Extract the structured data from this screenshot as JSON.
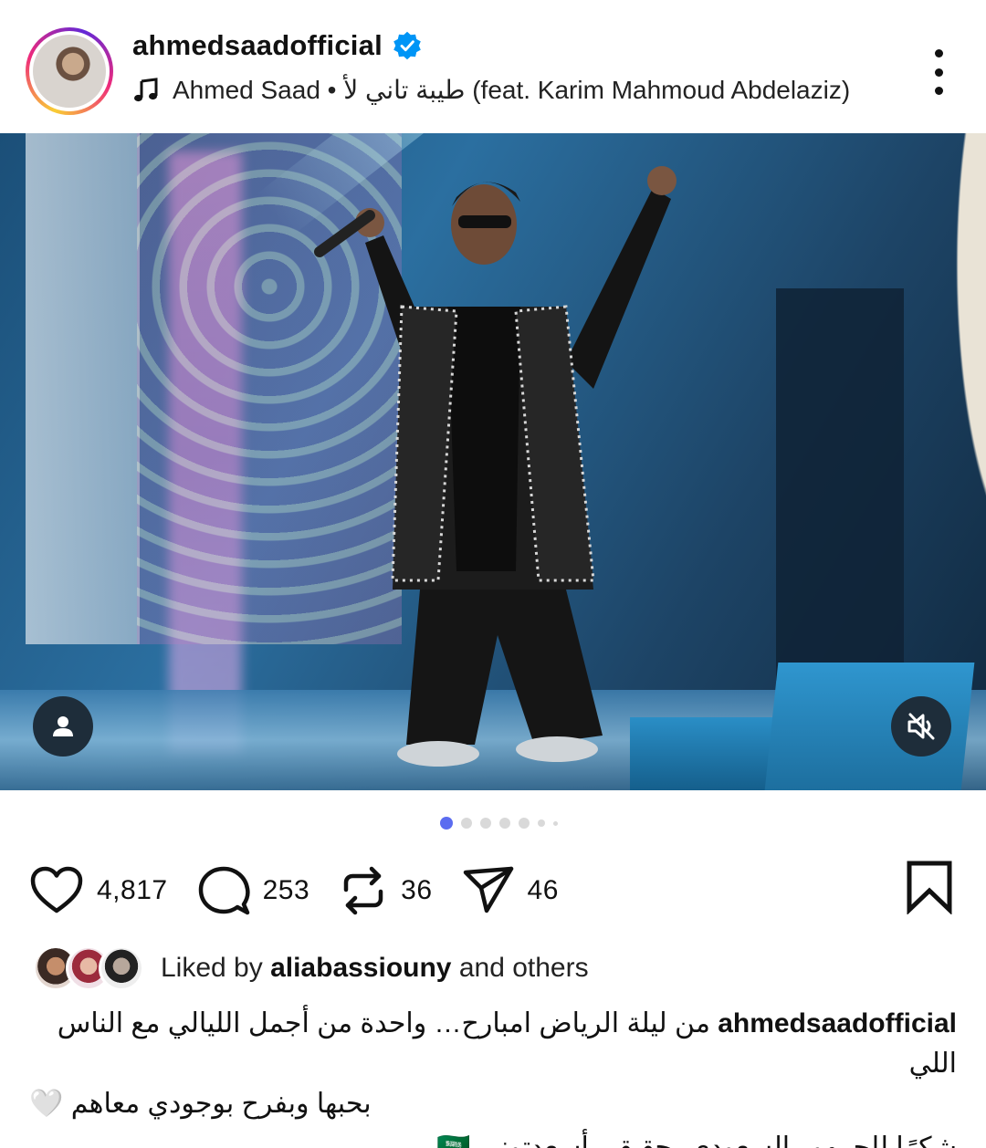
{
  "post": {
    "username": "ahmedsaadofficial",
    "verified": true,
    "song": "Ahmed Saad • طيبة تاني لأ (feat. Karim Mahmoud Abdelaziz)"
  },
  "media": {
    "type": "photo",
    "carousel_count": 7,
    "carousel_active_index": 0
  },
  "actions": {
    "likes": "4,817",
    "comments": "253",
    "reposts": "36",
    "shares": "46"
  },
  "liked_by": {
    "prefix": "Liked by ",
    "user": "aliabassiouny",
    "suffix": " and others"
  },
  "caption": {
    "username": "ahmedsaadofficial",
    "line1": "من ليلة الرياض امبارح… واحدة من أجمل الليالي مع الناس اللي",
    "line2": "بحبها وبفرح بوجودي معاهم 🤍",
    "line3": "شكرًا للجمهور السعودي، حقيقي أسعدتوني 🇸🇦"
  },
  "colors": {
    "accent_blue": "#0095f6",
    "dot_active": "#5b6cf0",
    "dot_inactive": "#d9d9d9"
  },
  "icons": [
    "verified-badge-icon",
    "music-note-icon",
    "more-vertical-icon",
    "user-tag-icon",
    "mute-icon",
    "heart-icon",
    "comment-icon",
    "repost-icon",
    "share-icon",
    "bookmark-icon"
  ]
}
